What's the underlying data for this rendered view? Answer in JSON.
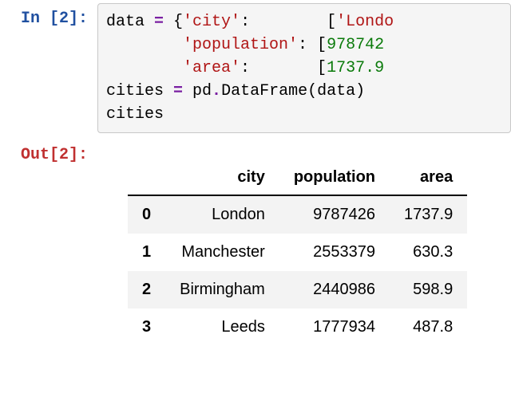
{
  "prompts": {
    "in": "In [2]:",
    "out": "Out[2]:"
  },
  "code": {
    "line1_a": "data ",
    "line1_op": "=",
    "line1_b": " {",
    "line1_key": "'city'",
    "line1_c": ":        [",
    "line1_val": "'Londo",
    "line2_a": "        ",
    "line2_key": "'population'",
    "line2_b": ": [",
    "line2_val": "978742",
    "line3_a": "        ",
    "line3_key": "'area'",
    "line3_b": ":       [",
    "line3_val": "1737.9",
    "line4_a": "cities ",
    "line4_op": "=",
    "line4_b": " pd",
    "line4_dot": ".",
    "line4_c": "DataFrame(data)",
    "line5": "cities"
  },
  "table": {
    "columns": [
      "",
      "city",
      "population",
      "area"
    ],
    "rows": [
      {
        "idx": "0",
        "city": "London",
        "population": "9787426",
        "area": "1737.9"
      },
      {
        "idx": "1",
        "city": "Manchester",
        "population": "2553379",
        "area": "630.3"
      },
      {
        "idx": "2",
        "city": "Birmingham",
        "population": "2440986",
        "area": "598.9"
      },
      {
        "idx": "3",
        "city": "Leeds",
        "population": "1777934",
        "area": "487.8"
      }
    ]
  },
  "chart_data": {
    "type": "table",
    "title": "",
    "columns": [
      "city",
      "population",
      "area"
    ],
    "index": [
      0,
      1,
      2,
      3
    ],
    "data": [
      [
        "London",
        9787426,
        1737.9
      ],
      [
        "Manchester",
        2553379,
        630.3
      ],
      [
        "Birmingham",
        2440986,
        598.9
      ],
      [
        "Leeds",
        1777934,
        487.8
      ]
    ]
  }
}
